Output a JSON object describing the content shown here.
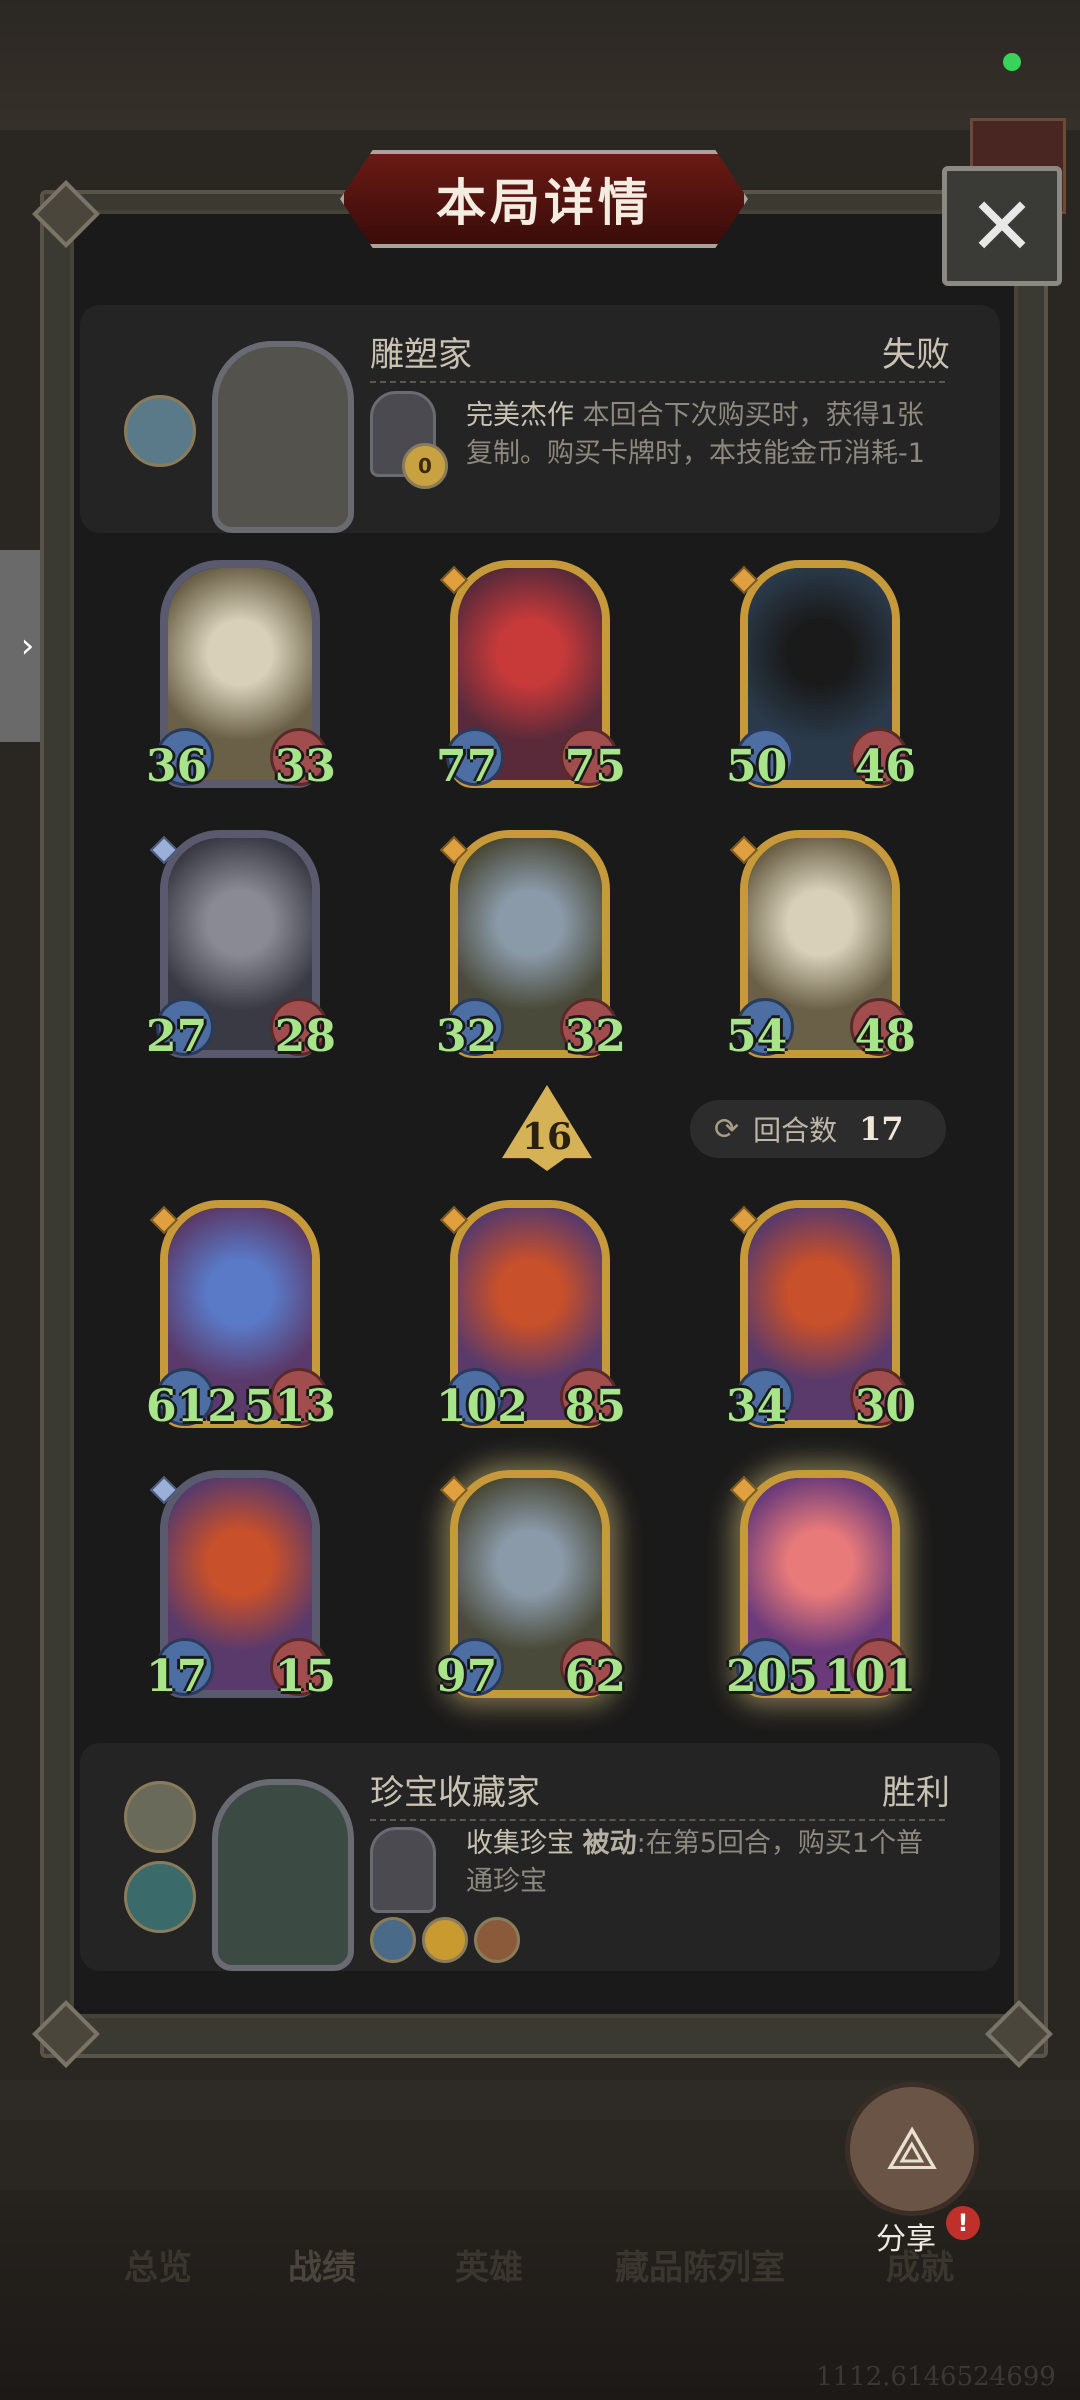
{
  "status": {
    "indicator_color": "#3ad35a"
  },
  "title": "本局详情",
  "close_label": "✕",
  "top_player": {
    "name": "雕塑家",
    "result": "失败",
    "skill_name": "完美杰作",
    "skill_desc": "本回合下次购买时，获得1张复制。购买卡牌时，本技能金币消耗-1",
    "skill_badge": "0"
  },
  "top_units": [
    {
      "atk": "36",
      "hp": "33",
      "frame": "silver",
      "art": "pelican"
    },
    {
      "atk": "77",
      "hp": "75",
      "frame": "gold",
      "art": "clown"
    },
    {
      "atk": "50",
      "hp": "46",
      "frame": "gold",
      "art": "orca"
    },
    {
      "atk": "27",
      "hp": "28",
      "frame": "silver",
      "art": "dragon"
    },
    {
      "atk": "32",
      "hp": "32",
      "frame": "gold",
      "art": "demon"
    },
    {
      "atk": "54",
      "hp": "48",
      "frame": "gold",
      "art": "pelican"
    }
  ],
  "round": {
    "level": "16",
    "label": "回合数",
    "count": "17"
  },
  "bottom_units": [
    {
      "atk": "612",
      "hp": "513",
      "frame": "gold",
      "art": "blue-dragon"
    },
    {
      "atk": "102",
      "hp": "85",
      "frame": "gold",
      "art": "redhead"
    },
    {
      "atk": "34",
      "hp": "30",
      "frame": "gold",
      "art": "redhead"
    },
    {
      "atk": "17",
      "hp": "15",
      "frame": "silver",
      "art": "redhead"
    },
    {
      "atk": "97",
      "hp": "62",
      "frame": "gold",
      "art": "demon"
    },
    {
      "atk": "205",
      "hp": "101",
      "frame": "gold",
      "art": "flamingo"
    }
  ],
  "bottom_player": {
    "name": "珍宝收藏家",
    "result": "胜利",
    "skill_name": "收集珍宝",
    "skill_tag": "被动",
    "skill_desc": ":在第5回合，购买1个普通珍宝"
  },
  "share": {
    "label": "分享",
    "alert": "!"
  },
  "nav": {
    "items": [
      "总览",
      "战绩",
      "英雄",
      "藏品陈列室",
      "成就"
    ]
  },
  "coordinate_text": "1112.6146524699"
}
